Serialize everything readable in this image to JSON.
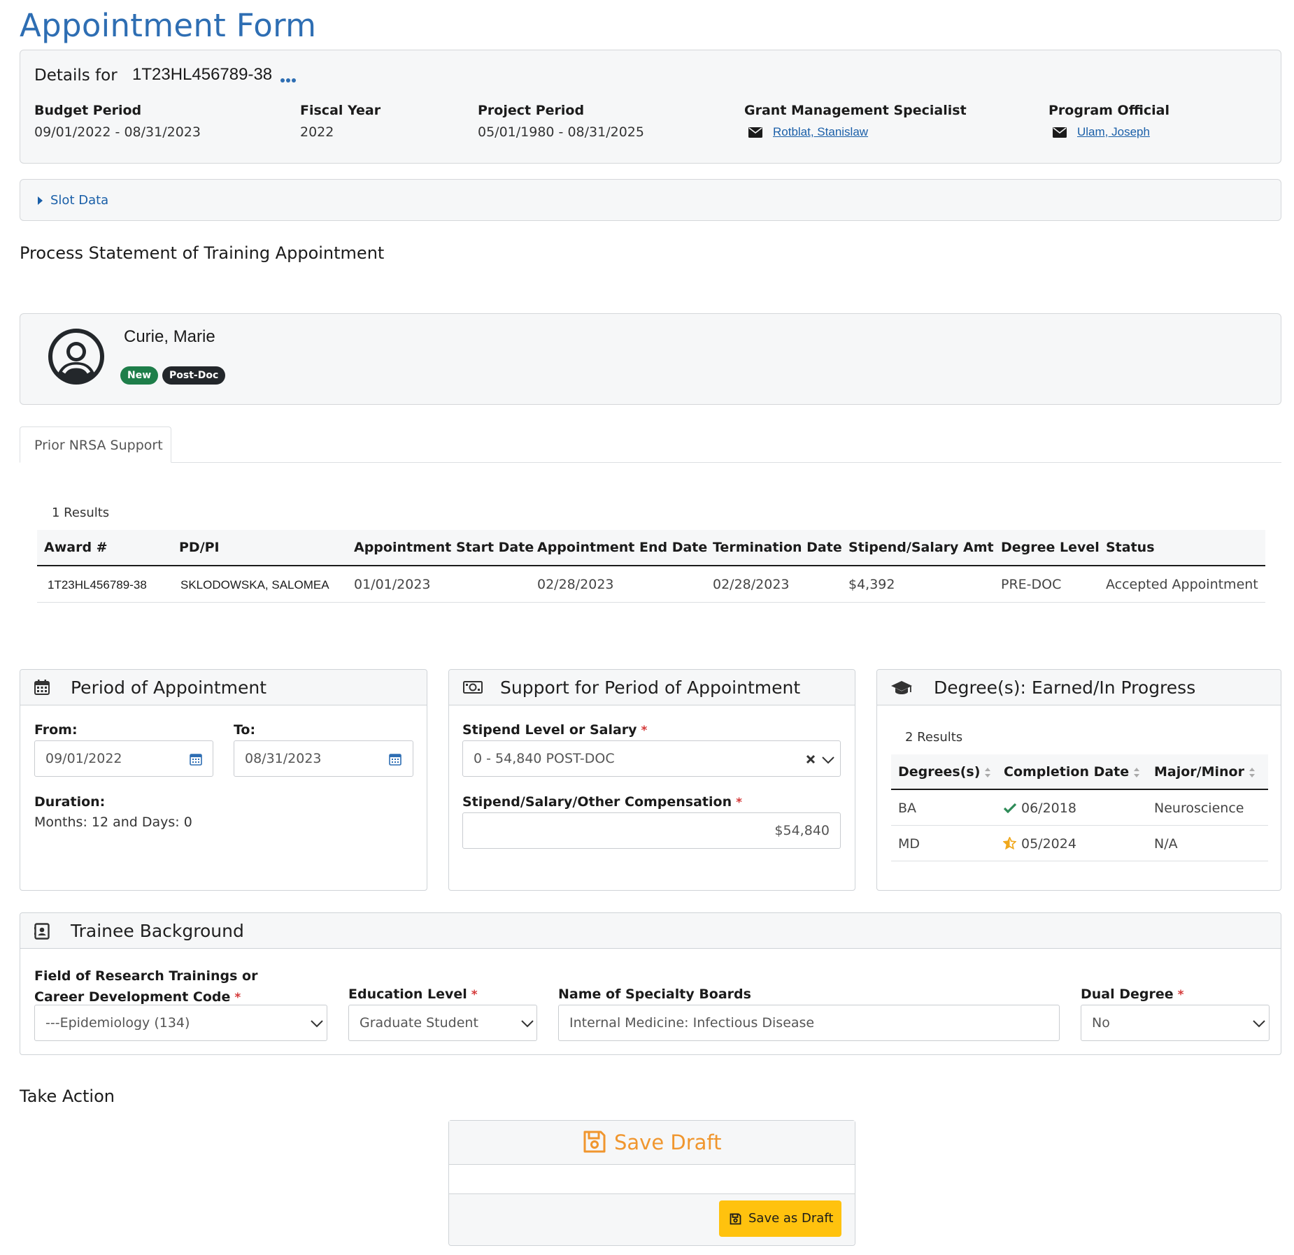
{
  "page": {
    "title": "Appointment Form"
  },
  "details": {
    "label": "Details for",
    "grant_id": "1T23HL456789-38",
    "budget_period": {
      "label": "Budget Period",
      "value": "09/01/2022 - 08/31/2023"
    },
    "fiscal_year": {
      "label": "Fiscal Year",
      "value": "2022"
    },
    "project_period": {
      "label": "Project Period",
      "value": "05/01/1980 - 08/31/2025"
    },
    "gms": {
      "label": "Grant Management Specialist",
      "name": "Rotblat, Stanislaw"
    },
    "po": {
      "label": "Program Official",
      "name": "Ulam, Joseph"
    }
  },
  "slot_data": {
    "label": "Slot Data"
  },
  "process_heading": "Process Statement of Training Appointment",
  "trainee": {
    "name": "Curie, Marie",
    "badges": [
      {
        "label": "New",
        "color": "#1e7e4a"
      },
      {
        "label": "Post-Doc",
        "color": "#23272b"
      }
    ]
  },
  "tabs": [
    {
      "label": "Prior NRSA Support"
    }
  ],
  "prior_support": {
    "results_text": "1 Results",
    "columns": [
      "Award #",
      "PD/PI",
      "Appointment Start Date",
      "Appointment End Date",
      "Termination Date",
      "Stipend/Salary Amt",
      "Degree Level",
      "Status"
    ],
    "rows": [
      [
        "1T23HL456789-38",
        "SKLODOWSKA, SALOMEA",
        "01/01/2023",
        "02/28/2023",
        "02/28/2023",
        "$4,392",
        "PRE-DOC",
        "Accepted Appointment"
      ]
    ]
  },
  "period": {
    "title": "Period of Appointment",
    "from_label": "From:",
    "from_value": "09/01/2022",
    "to_label": "To:",
    "to_value": "08/31/2023",
    "duration_label": "Duration:",
    "duration_value": "Months: 12 and Days: 0"
  },
  "support": {
    "title": "Support for Period of Appointment",
    "stipend_level_label": "Stipend Level or Salary",
    "stipend_level_value": "0 - 54,840 POST-DOC",
    "compensation_label": "Stipend/Salary/Other Compensation",
    "compensation_value": "$54,840"
  },
  "degrees": {
    "title": "Degree(s): Earned/In Progress",
    "results_text": "2 Results",
    "columns": [
      "Degrees(s)",
      "Completion Date",
      "Major/Minor"
    ],
    "rows": [
      {
        "degree": "BA",
        "status_icon": "check-icon",
        "date": "06/2018",
        "major": "Neuroscience"
      },
      {
        "degree": "MD",
        "status_icon": "star-half-icon",
        "date": "05/2024",
        "major": "N/A"
      }
    ]
  },
  "background": {
    "title": "Trainee Background",
    "field_label_line1": "Field of Research Trainings or",
    "field_label_line2": "Career Development Code",
    "field_value": "---Epidemiology (134)",
    "education_label": "Education Level",
    "education_value": "Graduate Student",
    "boards_label": "Name of Specialty Boards",
    "boards_value": "Internal Medicine: Infectious Disease",
    "dual_label": "Dual Degree",
    "dual_value": "No"
  },
  "take_action": {
    "heading": "Take Action",
    "save_draft_title": "Save Draft",
    "save_button": "Save as Draft"
  },
  "colors": {
    "title_blue": "#2e6eb3",
    "link_blue": "#1a5fa8",
    "required_red": "#d43838",
    "draft_orange": "#f0962e",
    "button_yellow": "#ffc20e",
    "check_green": "#2e8b57",
    "star_gold": "#f0a81c"
  }
}
